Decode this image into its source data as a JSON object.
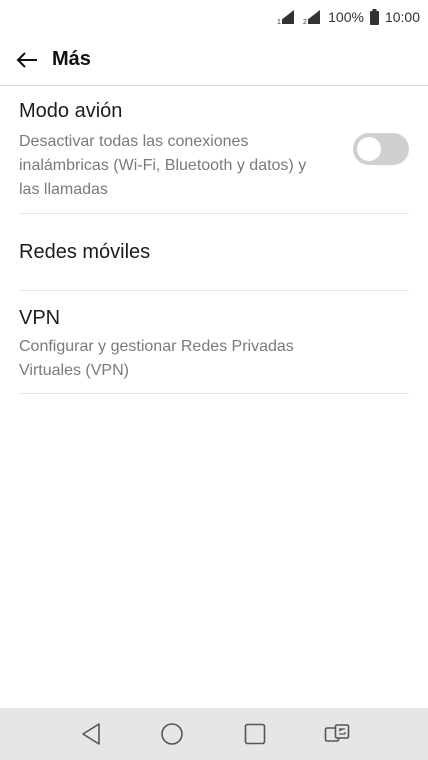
{
  "status_bar": {
    "battery_percent": "100%",
    "time": "10:00",
    "icons": [
      "sim1-signal-icon",
      "sim2-signal-icon",
      "battery-full-icon"
    ]
  },
  "header": {
    "title": "Más",
    "back_icon": "arrow-left-icon"
  },
  "settings": {
    "airplane": {
      "title": "Modo avión",
      "summary": "Desactivar todas las conexiones inalámbricas (Wi-Fi, Bluetooth y datos) y las llamadas",
      "toggle_on": false
    },
    "mobile_networks": {
      "title": "Redes móviles"
    },
    "vpn": {
      "title": "VPN",
      "summary": "Configurar y gestionar Redes Privadas Virtuales (VPN)"
    }
  },
  "nav_bar": {
    "buttons": [
      "back-triangle-icon",
      "home-circle-icon",
      "recents-square-icon",
      "dual-window-icon"
    ]
  },
  "colors": {
    "toggle_off": "#cfcfcf",
    "nav_background": "#e6e6e8",
    "summary_text": "#7a7a7a"
  }
}
